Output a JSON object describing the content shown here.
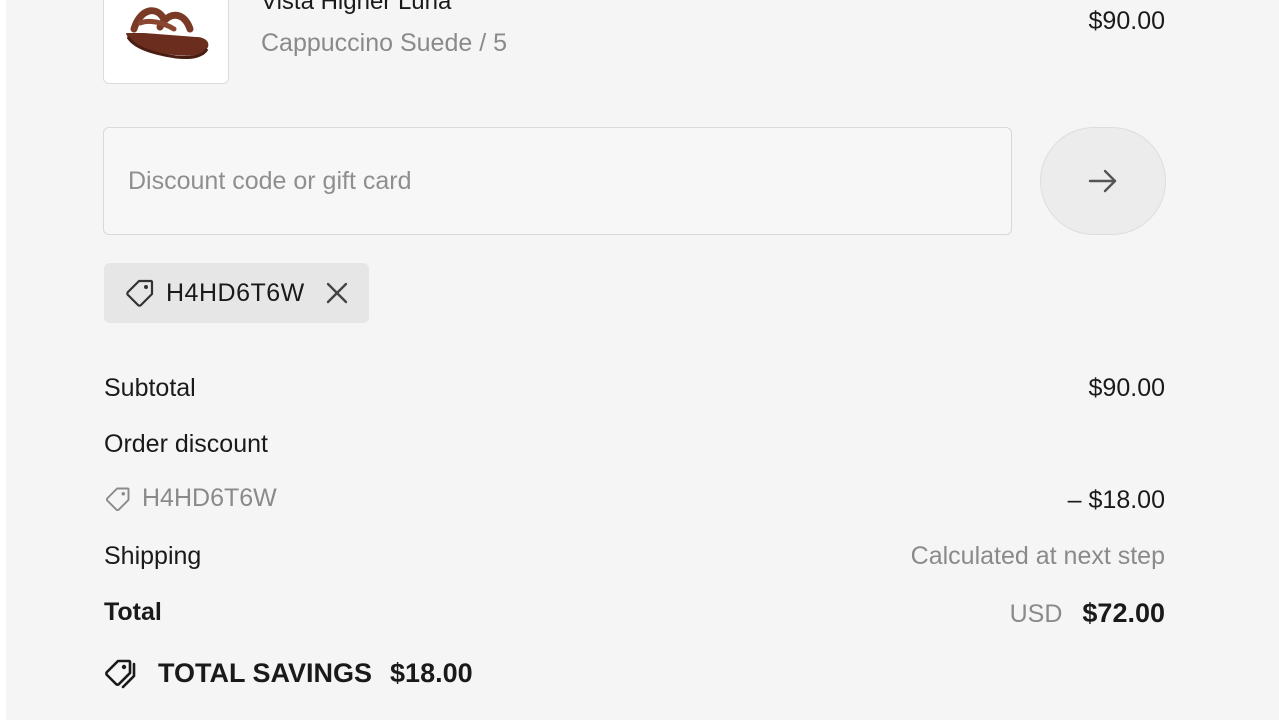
{
  "product": {
    "name": "Vista Higher Luna",
    "variant": "Cappuccino Suede / 5",
    "price": "$90.00",
    "image_alt": "sandal"
  },
  "discount": {
    "placeholder": "Discount code or gift card",
    "value": "",
    "apply_icon": "arrow-right-icon"
  },
  "applied_code": {
    "code": "H4HD6T6W",
    "tag_icon": "tag-icon",
    "remove_icon": "close-icon"
  },
  "summary": {
    "subtotal_label": "Subtotal",
    "subtotal_value": "$90.00",
    "order_discount_label": "Order discount",
    "discount_code": "H4HD6T6W",
    "discount_value": "– $18.00",
    "shipping_label": "Shipping",
    "shipping_value": "Calculated at next step",
    "total_label": "Total",
    "total_currency": "USD",
    "total_value": "$72.00"
  },
  "savings": {
    "label": "TOTAL SAVINGS",
    "amount": "$18.00",
    "icon": "tags-icon"
  },
  "colors": {
    "background": "#f5f5f5",
    "muted_text": "#8a8a8a",
    "chip_background": "#e6e6e6"
  }
}
